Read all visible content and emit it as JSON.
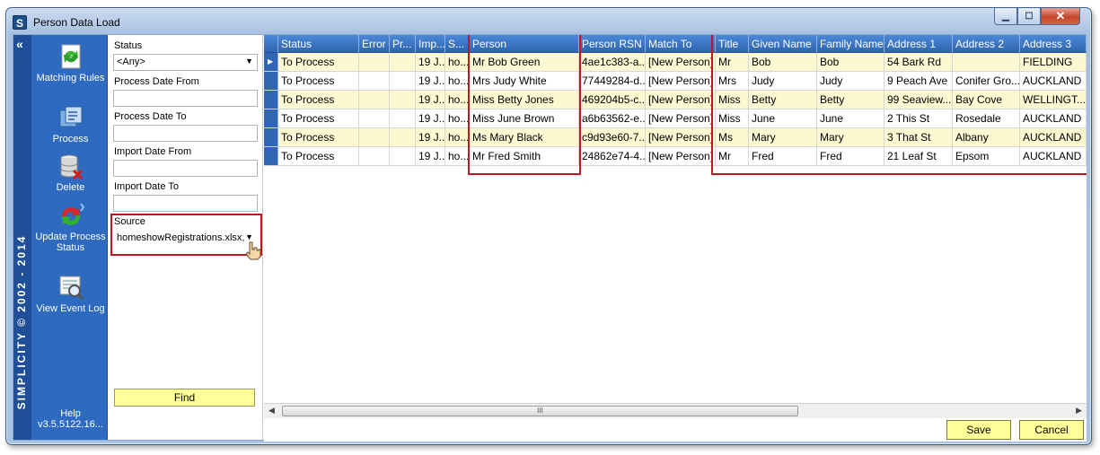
{
  "window": {
    "title": "Person Data Load",
    "app_icon": "S"
  },
  "nav": {
    "collapse": "«",
    "brand": "SIMPLICITY © 2002 - 2014",
    "items": [
      {
        "label": "Matching Rules",
        "icon": "matching-rules-icon"
      },
      {
        "label": "Process",
        "icon": "process-icon"
      },
      {
        "label": "Delete",
        "icon": "delete-icon"
      },
      {
        "label": "Update Process Status",
        "icon": "update-status-icon"
      },
      {
        "label": "View Event Log",
        "icon": "event-log-icon"
      }
    ],
    "help": "Help",
    "version": "v3.5.5122.16..."
  },
  "filters": {
    "status_label": "Status",
    "status_value": "<Any>",
    "process_from_label": "Process Date From",
    "process_to_label": "Process Date To",
    "import_from_label": "Import Date From",
    "import_to_label": "Import Date To",
    "source_label": "Source",
    "source_value": "homeshowRegistrations.xlsx,",
    "find_label": "Find"
  },
  "grid": {
    "columns": [
      "Status",
      "Error",
      "Pr...",
      "Imp...",
      "S...",
      "Person",
      "Person RSN",
      "Match To",
      "Title",
      "Given Name",
      "Family Name",
      "Address 1",
      "Address 2",
      "Address 3"
    ],
    "rows": [
      [
        "To Process",
        "",
        "",
        "19 J...",
        "ho...",
        "Mr Bob Green",
        "4ae1c383-a...",
        "[New Person]",
        "Mr",
        "Bob",
        "Bob",
        "54 Bark Rd",
        "",
        "FIELDING"
      ],
      [
        "To Process",
        "",
        "",
        "19 J...",
        "ho...",
        "Mrs Judy White",
        "77449284-d...",
        "[New Person]",
        "Mrs",
        "Judy",
        "Judy",
        "9 Peach Ave",
        "Conifer Gro...",
        "AUCKLAND"
      ],
      [
        "To Process",
        "",
        "",
        "19 J...",
        "ho...",
        "Miss Betty Jones",
        "469204b5-c...",
        "[New Person]",
        "Miss",
        "Betty",
        "Betty",
        "99 Seaview...",
        "Bay Cove",
        "WELLINGT..."
      ],
      [
        "To Process",
        "",
        "",
        "19 J...",
        "ho...",
        "Miss June Brown",
        "a6b63562-e...",
        "[New Person]",
        "Miss",
        "June",
        "June",
        "2 This St",
        "Rosedale",
        "AUCKLAND"
      ],
      [
        "To Process",
        "",
        "",
        "19 J...",
        "ho...",
        "Ms Mary Black",
        "c9d93e60-7...",
        "[New Person]",
        "Ms",
        "Mary",
        "Mary",
        "3 That St",
        "Albany",
        "AUCKLAND"
      ],
      [
        "To Process",
        "",
        "",
        "19 J...",
        "ho...",
        "Mr Fred Smith",
        "24862e74-4...",
        "[New Person]",
        "Mr",
        "Fred",
        "Fred",
        "21 Leaf St",
        "Epsom",
        "AUCKLAND"
      ]
    ],
    "scroll_grip": "III"
  },
  "footer": {
    "save": "Save",
    "cancel": "Cancel"
  },
  "colors": {
    "nav_blue": "#2d6ac0",
    "button_yellow": "#ffff99",
    "row_yellow": "#fbf8d2",
    "highlight_red": "#c0161d"
  }
}
